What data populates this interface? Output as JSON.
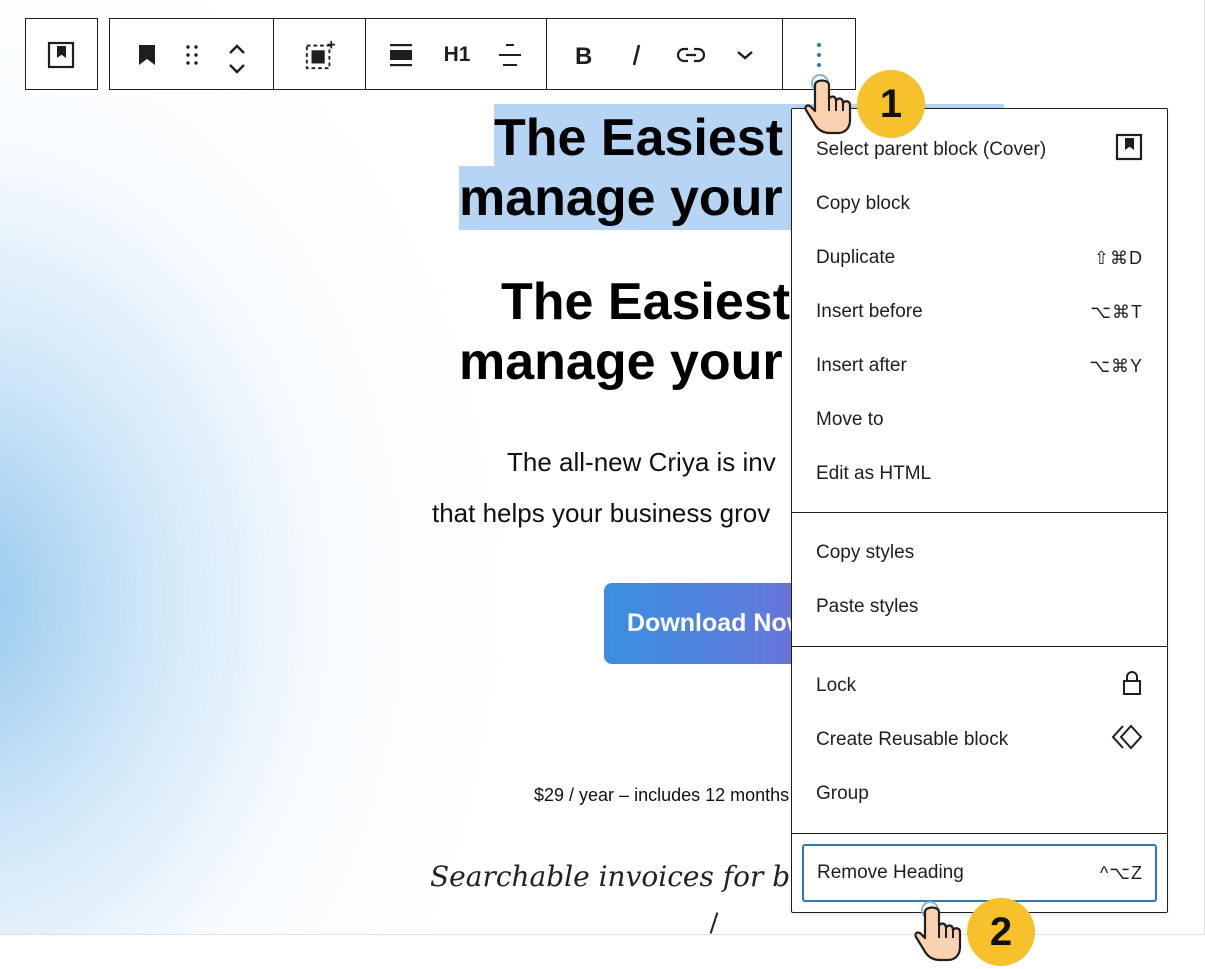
{
  "toolbar": {
    "transform_label": "H1"
  },
  "content": {
    "heading_selected_line1": "The Easiest",
    "heading_selected_line2": "manage your",
    "heading_line1": "The Easiest",
    "heading_line2": "manage your",
    "paragraph_line1": "The all-new Criya is inv",
    "paragraph_line2": "that helps your business grov",
    "download_button": "Download Now",
    "price_text": "$29 / year – includes 12 months",
    "script_text": "Searchable invoices for better"
  },
  "menu": {
    "group1": [
      {
        "label": "Select parent block (Cover)",
        "shortcut": "",
        "icon": "cover-block-icon"
      },
      {
        "label": "Copy block",
        "shortcut": ""
      },
      {
        "label": "Duplicate",
        "shortcut": "⇧⌘D"
      },
      {
        "label": "Insert before",
        "shortcut": "⌥⌘T"
      },
      {
        "label": "Insert after",
        "shortcut": "⌥⌘Y"
      },
      {
        "label": "Move to",
        "shortcut": ""
      },
      {
        "label": "Edit as HTML",
        "shortcut": ""
      }
    ],
    "group2": [
      {
        "label": "Copy styles"
      },
      {
        "label": "Paste styles"
      }
    ],
    "group3": [
      {
        "label": "Lock",
        "icon": "lock-icon"
      },
      {
        "label": "Create Reusable block",
        "icon": "reusable-block-icon"
      },
      {
        "label": "Group"
      }
    ],
    "remove": {
      "label": "Remove Heading",
      "shortcut": "^⌥Z"
    }
  },
  "callouts": {
    "step1": "1",
    "step2": "2"
  },
  "colors": {
    "selection": "#b6d4f3",
    "callout": "#f6c12b",
    "focus_border": "#2a7ab8",
    "button_gradient_start": "#3a8fdf",
    "button_gradient_end": "#7b63d6"
  }
}
